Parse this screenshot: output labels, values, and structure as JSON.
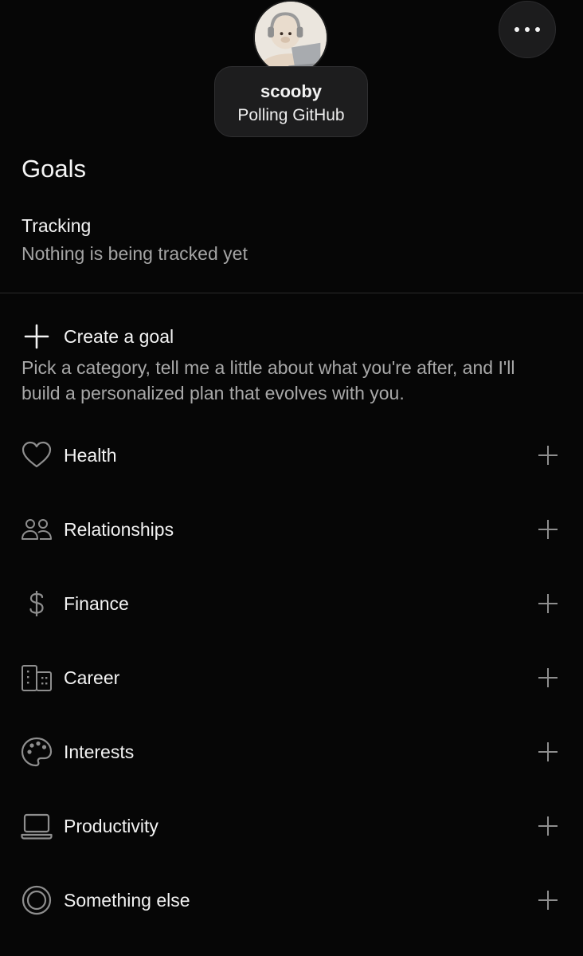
{
  "profile": {
    "name": "scooby",
    "status": "Polling GitHub"
  },
  "header": {
    "more_icon": "ellipsis-icon"
  },
  "goals": {
    "title": "Goals",
    "tracking_label": "Tracking",
    "tracking_empty": "Nothing is being tracked yet",
    "create_label": "Create a goal",
    "create_description": "Pick a category, tell me a little about what you're after, and I'll build a personalized plan that evolves with you.",
    "categories": [
      {
        "label": "Health",
        "icon": "heart-icon"
      },
      {
        "label": "Relationships",
        "icon": "people-icon"
      },
      {
        "label": "Finance",
        "icon": "dollar-icon"
      },
      {
        "label": "Career",
        "icon": "buildings-icon"
      },
      {
        "label": "Interests",
        "icon": "palette-icon"
      },
      {
        "label": "Productivity",
        "icon": "laptop-icon"
      },
      {
        "label": "Something else",
        "icon": "target-icon"
      }
    ]
  },
  "colors": {
    "background": "#060606",
    "text_primary": "#f2f2f2",
    "text_secondary": "#a6a6a6",
    "pill_background": "#1d1d1e",
    "divider": "#2a2a2a",
    "icon_muted": "#8e8e8e"
  }
}
